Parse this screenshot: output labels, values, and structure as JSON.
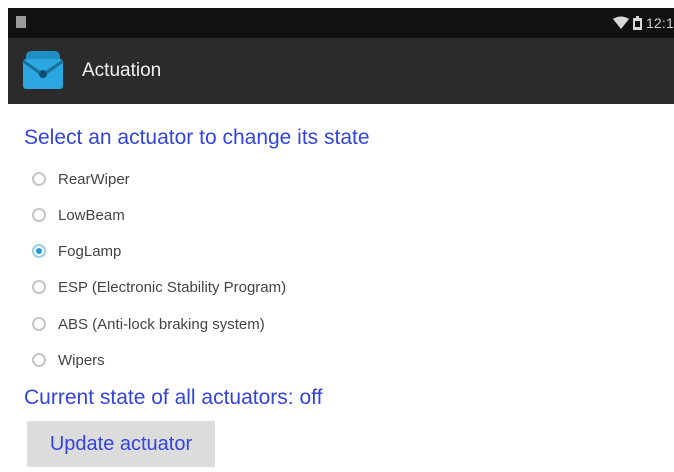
{
  "status_bar": {
    "time": "12:1",
    "notification_icon": "notification-icon",
    "wifi_icon": "wifi-icon",
    "battery_icon": "battery-icon"
  },
  "app_bar": {
    "title": "Actuation",
    "icon": "actuation-app-icon",
    "icon_color": "#2aa7e0"
  },
  "main": {
    "prompt": "Select an actuator to change its state",
    "actuators": [
      {
        "label": "RearWiper",
        "checked": false
      },
      {
        "label": "LowBeam",
        "checked": false
      },
      {
        "label": "FogLamp",
        "checked": true
      },
      {
        "label": "ESP (Electronic Stability Program)",
        "checked": false
      },
      {
        "label": "ABS (Anti-lock braking system)",
        "checked": false
      },
      {
        "label": "Wipers",
        "checked": false
      }
    ],
    "state_text": "Current state of all actuators: off",
    "update_button_label": "Update actuator"
  },
  "colors": {
    "accent_text": "#3344dd",
    "radio_selected": "#1e9bd8",
    "app_bar": "#2b2b2b",
    "status_bar": "#111111"
  }
}
